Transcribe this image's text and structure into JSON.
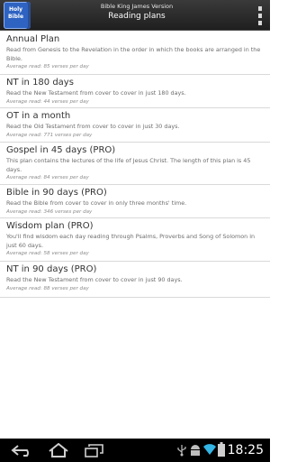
{
  "header": {
    "app_icon_text": [
      "Holy",
      "Bible"
    ],
    "subtitle": "Bible King James Version",
    "title": "Reading plans"
  },
  "plans": [
    {
      "name": "Annual Plan",
      "description": "Read from Genesis to the Revelation in the order in which the books are arranged in the Bible.",
      "average": "Average read: 85 verses per day"
    },
    {
      "name": "NT in 180 days",
      "description": "Read the New Testament from cover to cover in just 180 days.",
      "average": "Average read: 44 verses per day"
    },
    {
      "name": "OT in a month",
      "description": "Read the Old Testament from cover to cover in just 30 days.",
      "average": "Average read: 771 verses per day"
    },
    {
      "name": "Gospel in 45 days (PRO)",
      "description": "This plan contains the lectures of the life of Jesus Christ. The length of this plan is 45 days.",
      "average": "Average read: 84 verses per day"
    },
    {
      "name": "Bible in 90 days (PRO)",
      "description": "Read the Bible from cover to cover in only three months' time.",
      "average": "Average read: 346 verses per day"
    },
    {
      "name": "Wisdom plan (PRO)",
      "description": "You'll find wisdom each day reading through Psalms, Proverbs and Song of Solomon in just 60 days.",
      "average": "Average read: 58 verses per day"
    },
    {
      "name": "NT in 90 days (PRO)",
      "description": "Read the New Testament from cover to cover in just 90 days.",
      "average": "Average read: 88 verses per day"
    }
  ],
  "status_bar": {
    "time": "18:25",
    "icons": [
      "back-icon",
      "home-icon",
      "recent-apps-icon",
      "usb-icon",
      "android-debug-icon",
      "wifi-icon",
      "battery-icon"
    ]
  }
}
